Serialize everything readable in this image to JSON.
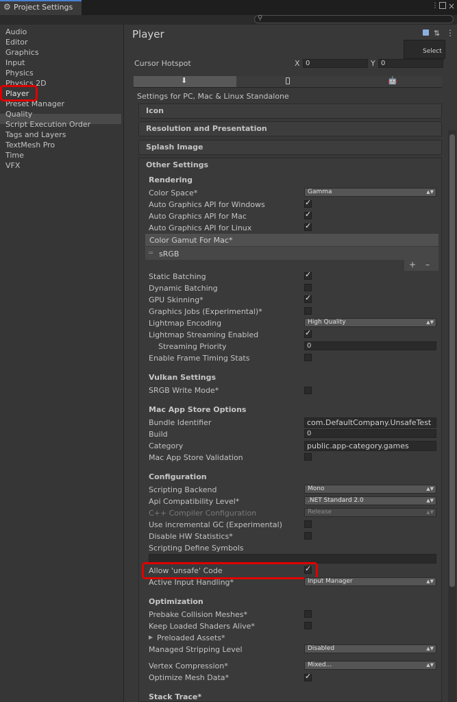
{
  "window": {
    "tab_title": "Project Settings",
    "tab_icon": "gear-icon"
  },
  "sidebar": {
    "items": [
      "Audio",
      "Editor",
      "Graphics",
      "Input",
      "Physics",
      "Physics 2D",
      "Player",
      "Preset Manager",
      "Quality",
      "Script Execution Order",
      "Tags and Layers",
      "TextMesh Pro",
      "Time",
      "VFX"
    ],
    "selected": "Player"
  },
  "main": {
    "title": "Player",
    "select_label": "Select",
    "cursor_hotspot": {
      "label": "Cursor Hotspot",
      "x_label": "X",
      "x_value": "0",
      "y_label": "Y",
      "y_value": "0"
    },
    "settings_for": "Settings for PC, Mac & Linux Standalone",
    "sections": {
      "icon": "Icon",
      "resolution": "Resolution and Presentation",
      "splash": "Splash Image",
      "other": "Other Settings"
    }
  },
  "rendering": {
    "title": "Rendering",
    "color_space": {
      "label": "Color Space*",
      "value": "Gamma"
    },
    "api_windows": "Auto Graphics API  for Windows",
    "api_mac": "Auto Graphics API  for Mac",
    "api_linux": "Auto Graphics API  for Linux",
    "gamut_header": "Color Gamut For Mac*",
    "gamut_item": "sRGB",
    "static_batching": "Static Batching",
    "dynamic_batching": "Dynamic Batching",
    "gpu_skinning": "GPU Skinning*",
    "graphics_jobs": "Graphics Jobs (Experimental)*",
    "lightmap_encoding": {
      "label": "Lightmap Encoding",
      "value": "High Quality"
    },
    "lightmap_streaming": "Lightmap Streaming Enabled",
    "streaming_priority": {
      "label": "Streaming Priority",
      "value": "0"
    },
    "frame_timing": "Enable Frame Timing Stats"
  },
  "vulkan": {
    "title": "Vulkan Settings",
    "srgb": "SRGB Write Mode*"
  },
  "mac_store": {
    "title": "Mac App Store Options",
    "bundle": {
      "label": "Bundle Identifier",
      "value": "com.DefaultCompany.UnsafeTest"
    },
    "build": {
      "label": "Build",
      "value": "0"
    },
    "category": {
      "label": "Category",
      "value": "public.app-category.games"
    },
    "validation": "Mac App Store Validation"
  },
  "configuration": {
    "title": "Configuration",
    "backend": {
      "label": "Scripting Backend",
      "value": "Mono"
    },
    "api_level": {
      "label": "Api Compatibility Level*",
      "value": ".NET Standard 2.0"
    },
    "cpp_config": {
      "label": "C++ Compiler Configuration",
      "value": "Release"
    },
    "incremental_gc": "Use incremental GC (Experimental)",
    "hw_stats": "Disable HW Statistics*",
    "define_symbols": "Scripting Define Symbols",
    "unsafe_code": "Allow 'unsafe' Code",
    "input_handling": {
      "label": "Active Input Handling*",
      "value": "Input Manager"
    }
  },
  "optimization": {
    "title": "Optimization",
    "prebake": "Prebake Collision Meshes*",
    "keep_shaders": "Keep Loaded Shaders Alive*",
    "preloaded": "Preloaded Assets*",
    "stripping": {
      "label": "Managed Stripping Level",
      "value": "Disabled"
    },
    "vertex": {
      "label": "Vertex Compression*",
      "value": "Mixed..."
    },
    "optimize_mesh": "Optimize Mesh Data*"
  },
  "stack_trace": {
    "title": "Stack Trace*"
  },
  "colors": {
    "highlight": "#e00000",
    "background": "#383838"
  }
}
